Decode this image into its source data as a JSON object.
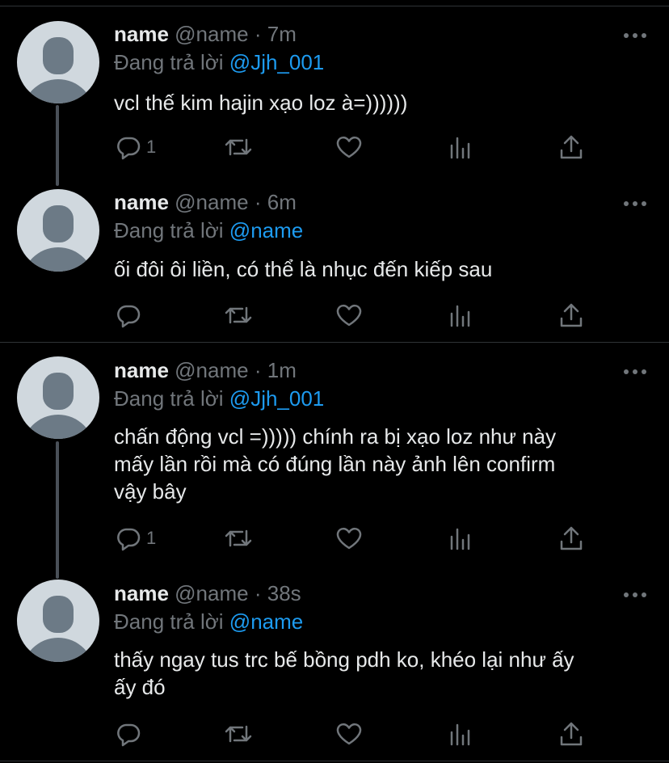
{
  "tweets": [
    {
      "name": "name",
      "handle": "@name",
      "dot": "·",
      "time": "7m",
      "reply_prefix": "Đang trả lời",
      "reply_to": "@Jjh_001",
      "lines": [
        "vcl thế kim hajin xạo loz à=))))))"
      ],
      "reply_count": "1"
    },
    {
      "name": "name",
      "handle": "@name",
      "dot": "·",
      "time": "6m",
      "reply_prefix": "Đang trả lời",
      "reply_to": "@name",
      "lines": [
        "ối đôi ôi liền, có thể là nhục đến kiếp sau"
      ],
      "reply_count": ""
    },
    {
      "name": "name",
      "handle": "@name",
      "dot": "·",
      "time": "1m",
      "reply_prefix": "Đang trả lời",
      "reply_to": "@Jjh_001",
      "lines": [
        "chấn động vcl =))))) chính ra bị xạo loz như này",
        "mấy lần rồi mà có đúng lần này ảnh lên confirm",
        "vậy bây"
      ],
      "reply_count": "1"
    },
    {
      "name": "name",
      "handle": "@name",
      "dot": "·",
      "time": "38s",
      "reply_prefix": "Đang trả lời",
      "reply_to": "@name",
      "lines": [
        "thấy ngay tus trc bế bồng pdh ko, khéo lại như ấy",
        "ấy đó"
      ],
      "reply_count": ""
    }
  ],
  "icons": {
    "reply": "reply-icon",
    "retweet": "retweet-icon",
    "like": "heart-icon",
    "views": "views-icon",
    "share": "share-icon",
    "more": "more-icon",
    "avatar": "avatar-icon"
  },
  "colors": {
    "background": "#000000",
    "text": "#e7e9ea",
    "muted": "#71767b",
    "mention": "#1d9bf0",
    "divider": "#2f3336"
  }
}
